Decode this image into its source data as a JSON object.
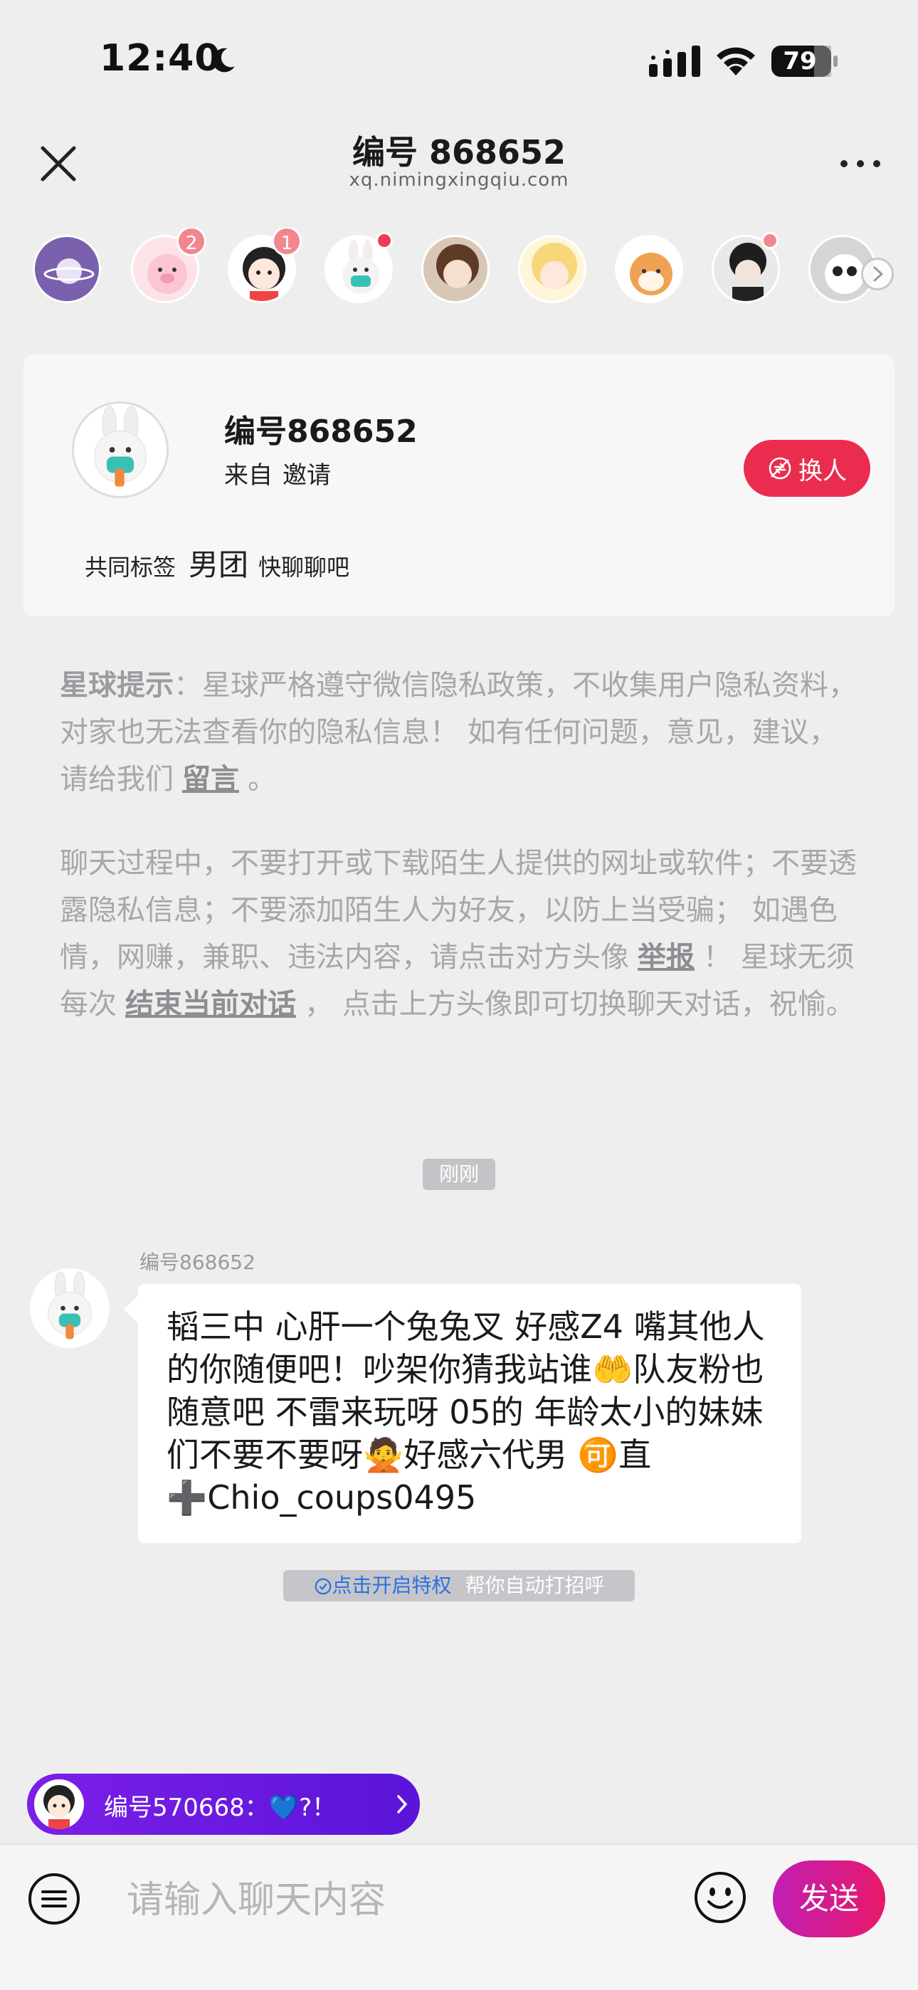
{
  "status_bar": {
    "time": "12:40",
    "battery": "79"
  },
  "header": {
    "title": "编号 868652",
    "subtitle": "xq.nimingxingqiu.com"
  },
  "avatar_strip": [
    {
      "name": "planet",
      "badge": ""
    },
    {
      "name": "pig",
      "badge": "2"
    },
    {
      "name": "girl",
      "badge": "1"
    },
    {
      "name": "bunny",
      "badge": "dot"
    },
    {
      "name": "anime-girl",
      "badge": ""
    },
    {
      "name": "anime-blonde",
      "badge": ""
    },
    {
      "name": "shiba",
      "badge": ""
    },
    {
      "name": "man",
      "badge": "dot"
    },
    {
      "name": "panda",
      "badge": ""
    }
  ],
  "profile": {
    "name": "编号868652",
    "from_label": "来自",
    "from_value": "邀请",
    "swap_label": "换人",
    "tags_label": "共同标签",
    "tag": "男团",
    "tag_hint": "快聊聊吧"
  },
  "notice": {
    "p1_bold": "星球提示",
    "p1_text": "：星球严格遵守微信隐私政策，不收集用户隐私资料，对家也无法查看你的隐私信息！ 如有任何问题，意见，建议，请给我们",
    "p1_link": "留言",
    "p1_end": "。",
    "p2_text": "聊天过程中，不要打开或下载陌生人提供的网址或软件；不要透露隐私信息；不要添加陌生人为好友，以防上当受骗； 如遇色情，网赚，兼职、违法内容，请点击对方头像",
    "p2_link1": "举报",
    "p2_mid": "！ 星球无须每次",
    "p2_link2": "结束当前对话",
    "p2_end": "， 点击上方头像即可切换聊天对话，祝愉。"
  },
  "chat": {
    "time": "刚刚",
    "sender": "编号868652",
    "message": "韬三中 心肝一个兔兔叉 好感Z4 嘴其他人的你随便吧！吵架你猜我站谁🤲队友粉也随意吧 不雷来玩呀 05的 年龄太小的妹妹们不要不要呀🙅好感六代男 🉑直➕Chio_coups0495",
    "perk_link": "点击开启特权",
    "perk_text": "帮你自动打招呼"
  },
  "toast": {
    "text": "编号570668：💙?！"
  },
  "input": {
    "placeholder": "请输入聊天内容",
    "send_label": "发送"
  }
}
